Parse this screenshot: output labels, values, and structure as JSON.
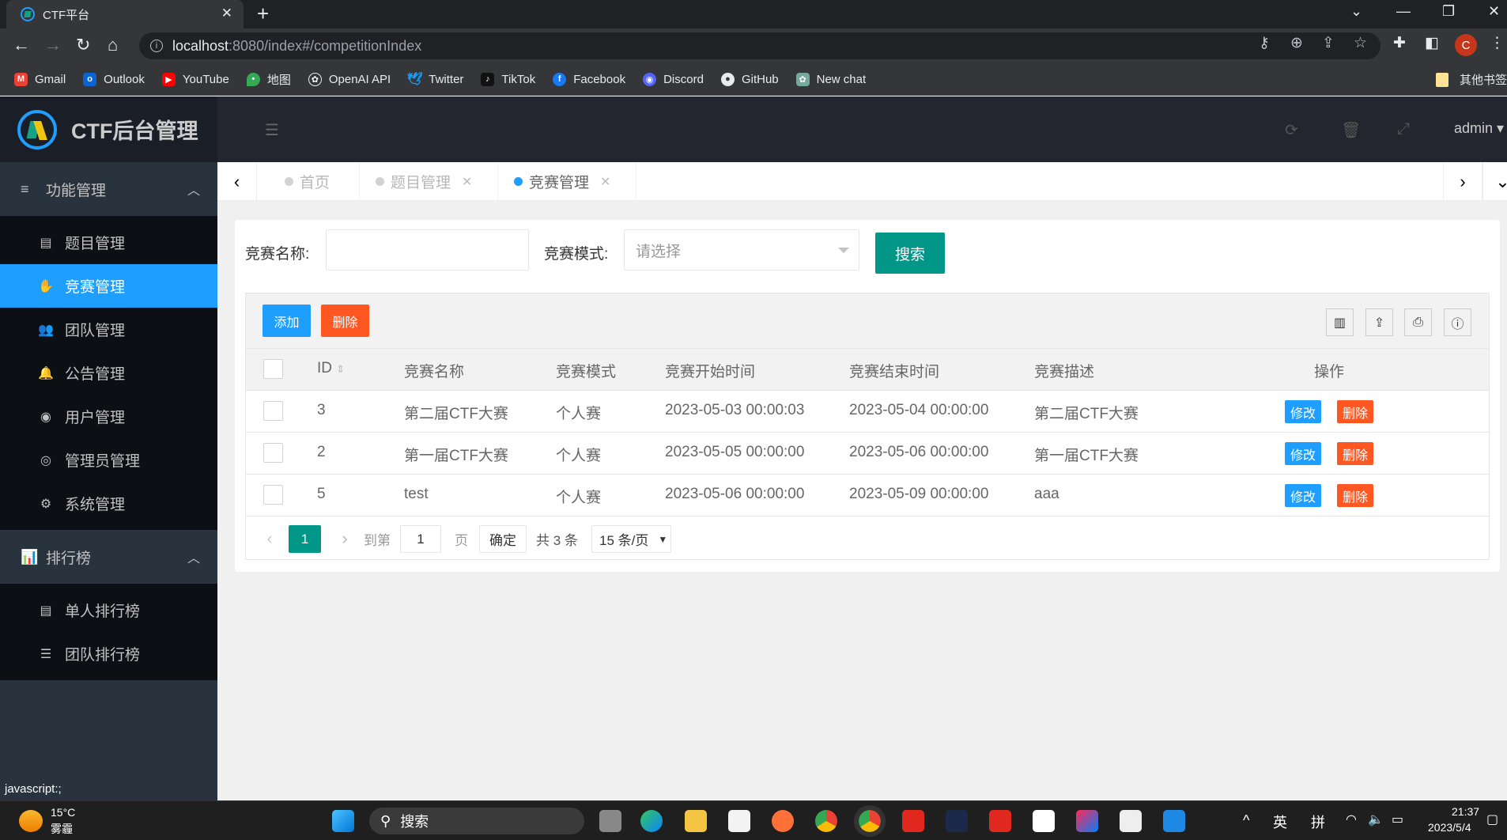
{
  "browser": {
    "tab_title": "CTF平台",
    "url_host": "localhost",
    "url_path": ":8080/index#/competitionIndex",
    "profile_initial": "C",
    "bookmarks": [
      {
        "label": "Gmail",
        "icon": "gmail-icon",
        "color": "#ea4335"
      },
      {
        "label": "Outlook",
        "icon": "outlook-icon",
        "color": "#0a64d6"
      },
      {
        "label": "YouTube",
        "icon": "youtube-icon",
        "color": "#ff0000"
      },
      {
        "label": "地图",
        "icon": "maps-icon",
        "color": "#34a853"
      },
      {
        "label": "OpenAI API",
        "icon": "openai-icon",
        "color": "#202124"
      },
      {
        "label": "Twitter",
        "icon": "twitter-icon",
        "color": "#1d9bf0"
      },
      {
        "label": "TikTok",
        "icon": "tiktok-icon",
        "color": "#111111"
      },
      {
        "label": "Facebook",
        "icon": "facebook-icon",
        "color": "#1877f2"
      },
      {
        "label": "Discord",
        "icon": "discord-icon",
        "color": "#5865f2"
      },
      {
        "label": "GitHub",
        "icon": "github-icon",
        "color": "#35363a"
      },
      {
        "label": "New chat",
        "icon": "chatgpt-icon",
        "color": "#74aa9c"
      }
    ],
    "other_bookmarks": "其他书签"
  },
  "app": {
    "title": "CTF后台管理",
    "user": "admin",
    "accent": "#1e9fff",
    "sidebar": {
      "groups": [
        {
          "label": "功能管理",
          "icon": "menu-icon",
          "items": [
            {
              "label": "题目管理",
              "icon": "server-icon",
              "active": false
            },
            {
              "label": "竞赛管理",
              "icon": "hand-icon",
              "active": true
            },
            {
              "label": "团队管理",
              "icon": "users-icon",
              "active": false
            },
            {
              "label": "公告管理",
              "icon": "bell-icon",
              "active": false
            },
            {
              "label": "用户管理",
              "icon": "user-circle-icon",
              "active": false
            },
            {
              "label": "管理员管理",
              "icon": "admin-circle-icon",
              "active": false
            },
            {
              "label": "系统管理",
              "icon": "gear-icon",
              "active": false
            }
          ]
        },
        {
          "label": "排行榜",
          "icon": "bar-chart-icon",
          "items": [
            {
              "label": "单人排行榜",
              "icon": "list-alt-icon",
              "active": false
            },
            {
              "label": "团队排行榜",
              "icon": "list-icon",
              "active": false
            }
          ]
        }
      ]
    },
    "page_tabs": [
      {
        "label": "首页",
        "closable": false,
        "active": false
      },
      {
        "label": "题目管理",
        "closable": true,
        "active": false
      },
      {
        "label": "竞赛管理",
        "closable": true,
        "active": true
      }
    ],
    "search": {
      "name_label": "竞赛名称:",
      "name_value": "",
      "mode_label": "竞赛模式:",
      "mode_placeholder": "请选择",
      "search_button": "搜索"
    },
    "table": {
      "add_button": "添加",
      "delete_button": "删除",
      "tool_icons": [
        "columns-icon",
        "export-icon",
        "print-icon",
        "info-icon"
      ],
      "columns": [
        "ID",
        "竞赛名称",
        "竞赛模式",
        "竞赛开始时间",
        "竞赛结束时间",
        "竞赛描述",
        "操作"
      ],
      "rows": [
        {
          "id": "3",
          "name": "第二届CTF大赛",
          "mode": "个人赛",
          "start": "2023-05-03 00:00:03",
          "end": "2023-05-04 00:00:00",
          "desc": "第二届CTF大赛"
        },
        {
          "id": "2",
          "name": "第一届CTF大赛",
          "mode": "个人赛",
          "start": "2023-05-05 00:00:00",
          "end": "2023-05-06 00:00:00",
          "desc": "第一届CTF大赛"
        },
        {
          "id": "5",
          "name": "test",
          "mode": "个人赛",
          "start": "2023-05-06 00:00:00",
          "end": "2023-05-09 00:00:00",
          "desc": "aaa"
        }
      ],
      "edit_label": "修改",
      "row_delete_label": "删除"
    },
    "pagination": {
      "current_page": "1",
      "goto_label": "到第",
      "goto_value": "1",
      "page_unit": "页",
      "confirm": "确定",
      "total": "共 3 条",
      "page_size": "15 条/页"
    }
  },
  "status_tooltip": "javascript:;",
  "taskbar": {
    "weather_temp": "15°C",
    "weather_desc": "雾霾",
    "search_label": "搜索",
    "ime_lang": "英",
    "ime_mode": "拼",
    "time": "21:37",
    "date": "2023/5/4"
  }
}
